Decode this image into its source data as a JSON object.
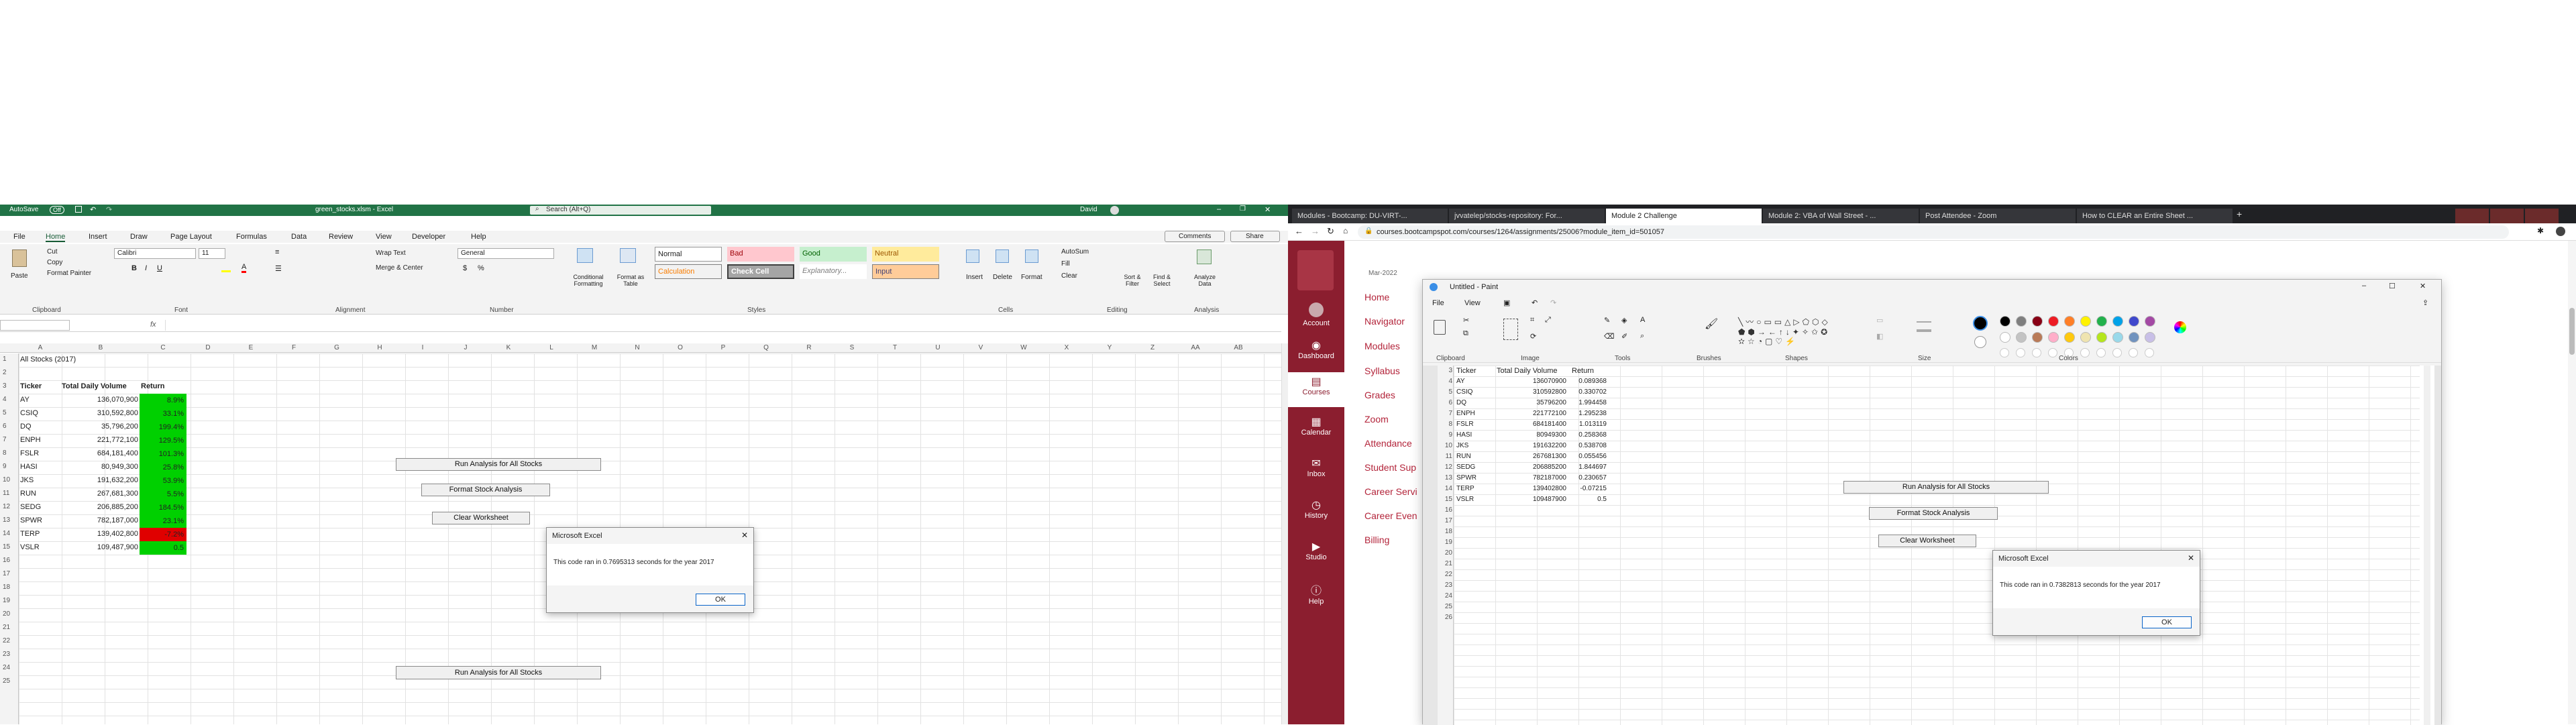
{
  "excel": {
    "autosave_label": "AutoSave",
    "autosave_state": "Off",
    "title": "green_stocks.xlsm - Excel",
    "search_placeholder": "Search (Alt+Q)",
    "user": "David",
    "menu_tabs": [
      "File",
      "Home",
      "Insert",
      "Draw",
      "Page Layout",
      "Formulas",
      "Data",
      "Review",
      "View",
      "Developer",
      "Help"
    ],
    "comments_label": "Comments",
    "share_label": "Share",
    "ribbon": {
      "paste": "Paste",
      "cut": "Cut",
      "copy": "Copy",
      "format_painter": "Format Painter",
      "font_name": "Calibri",
      "font_size": "11",
      "wrap_text": "Wrap Text",
      "merge_center": "Merge & Center",
      "number_format": "General",
      "conditional": "Conditional Formatting",
      "format_table": "Format as Table",
      "styles": [
        "Normal",
        "Bad",
        "Good",
        "Neutral",
        "Calculation",
        "Check Cell",
        "Explanatory...",
        "Input"
      ],
      "insert": "Insert",
      "delete": "Delete",
      "format": "Format",
      "autosum": "AutoSum",
      "fill": "Fill",
      "clear": "Clear",
      "sort_filter": "Sort & Filter",
      "find_select": "Find & Select",
      "analyze": "Analyze Data",
      "groups": [
        "Clipboard",
        "Font",
        "Alignment",
        "Number",
        "Styles",
        "Cells",
        "Editing",
        "Analysis"
      ]
    },
    "name_box": "",
    "formula_fx": "fx",
    "columns": [
      "A",
      "B",
      "C",
      "D",
      "E",
      "F",
      "G",
      "H",
      "I",
      "J",
      "K",
      "L",
      "M",
      "N",
      "O",
      "P",
      "Q",
      "R",
      "S",
      "T",
      "U",
      "V",
      "W",
      "X",
      "Y",
      "Z",
      "AA",
      "AB"
    ],
    "row_numbers": [
      "1",
      "2",
      "3",
      "4",
      "5",
      "6",
      "7",
      "8",
      "9",
      "10",
      "11",
      "12",
      "13",
      "14",
      "15",
      "16",
      "17",
      "18",
      "19",
      "20",
      "21",
      "22",
      "23",
      "24",
      "25"
    ],
    "sheet_title": "All Stocks (2017)",
    "headers": [
      "Ticker",
      "Total Daily Volume",
      "Return"
    ],
    "rows": [
      {
        "ticker": "AY",
        "volume": "136,070,900",
        "ret": "8.9%",
        "color": "#00d000"
      },
      {
        "ticker": "CSIQ",
        "volume": "310,592,800",
        "ret": "33.1%",
        "color": "#00d000"
      },
      {
        "ticker": "DQ",
        "volume": "35,796,200",
        "ret": "199.4%",
        "color": "#00d000"
      },
      {
        "ticker": "ENPH",
        "volume": "221,772,100",
        "ret": "129.5%",
        "color": "#00d000"
      },
      {
        "ticker": "FSLR",
        "volume": "684,181,400",
        "ret": "101.3%",
        "color": "#00d000"
      },
      {
        "ticker": "HASI",
        "volume": "80,949,300",
        "ret": "25.8%",
        "color": "#00d000"
      },
      {
        "ticker": "JKS",
        "volume": "191,632,200",
        "ret": "53.9%",
        "color": "#00d000"
      },
      {
        "ticker": "RUN",
        "volume": "267,681,300",
        "ret": "5.5%",
        "color": "#00d000"
      },
      {
        "ticker": "SEDG",
        "volume": "206,885,200",
        "ret": "184.5%",
        "color": "#00d000"
      },
      {
        "ticker": "SPWR",
        "volume": "782,187,000",
        "ret": "23.1%",
        "color": "#00d000"
      },
      {
        "ticker": "TERP",
        "volume": "139,402,800",
        "ret": "-7.2%",
        "color": "#e00000"
      },
      {
        "ticker": "VSLR",
        "volume": "109,487,900",
        "ret": "0.5",
        "color": "#00d000"
      }
    ],
    "buttons": {
      "run": "Run Analysis for All Stocks",
      "format": "Format Stock Analysis",
      "clear": "Clear Worksheet"
    },
    "dialog": {
      "title": "Microsoft Excel",
      "message": "This code ran in 0.7695313 seconds for the year 2017",
      "ok": "OK"
    }
  },
  "browser": {
    "tabs": [
      "Modules - Bootcamp: DU-VIRT-...",
      "jvvatelep/stocks-repository: For...",
      "Module 2 Challenge",
      "Module 2: VBA of Wall Street - ...",
      "Post Attendee - Zoom",
      "How to CLEAR an Entire Sheet ..."
    ],
    "url": "courses.bootcampspot.com/courses/1264/assignments/25006?module_item_id=501057",
    "canvas_nav": [
      "Account",
      "Dashboard",
      "Courses",
      "Calendar",
      "Inbox",
      "History",
      "Studio",
      "Help"
    ],
    "course_date": "Mar-2022",
    "course_nav": [
      "Home",
      "Navigator",
      "Modules",
      "Syllabus",
      "Grades",
      "Zoom",
      "Attendance",
      "Student Sup",
      "Career Servi",
      "Career Even",
      "Billing"
    ]
  },
  "paint": {
    "title": "Untitled - Paint",
    "menu": [
      "File",
      "View"
    ],
    "groups": [
      "Clipboard",
      "Image",
      "Tools",
      "Brushes",
      "Shapes",
      "Size",
      "Colors"
    ],
    "row_numbers": [
      "3",
      "4",
      "5",
      "6",
      "7",
      "8",
      "9",
      "10",
      "11",
      "12",
      "13",
      "14",
      "15",
      "16",
      "17",
      "18",
      "19",
      "20",
      "21",
      "22",
      "23",
      "24",
      "25",
      "26"
    ],
    "headers": [
      "Ticker",
      "Total Daily Volume",
      "Return"
    ],
    "rows": [
      {
        "ticker": "AY",
        "volume": "136070900",
        "ret": "0.089368"
      },
      {
        "ticker": "CSIQ",
        "volume": "310592800",
        "ret": "0.330702"
      },
      {
        "ticker": "DQ",
        "volume": "35796200",
        "ret": "1.994458"
      },
      {
        "ticker": "ENPH",
        "volume": "221772100",
        "ret": "1.295238"
      },
      {
        "ticker": "FSLR",
        "volume": "684181400",
        "ret": "1.013119"
      },
      {
        "ticker": "HASI",
        "volume": "80949300",
        "ret": "0.258368"
      },
      {
        "ticker": "JKS",
        "volume": "191632200",
        "ret": "0.538708"
      },
      {
        "ticker": "RUN",
        "volume": "267681300",
        "ret": "0.055456"
      },
      {
        "ticker": "SEDG",
        "volume": "206885200",
        "ret": "1.844697"
      },
      {
        "ticker": "SPWR",
        "volume": "782187000",
        "ret": "0.230657"
      },
      {
        "ticker": "TERP",
        "volume": "139402800",
        "ret": "-0.07215"
      },
      {
        "ticker": "VSLR",
        "volume": "109487900",
        "ret": "0.5"
      }
    ],
    "buttons": {
      "run": "Run Analysis for All Stocks",
      "format": "Format Stock Analysis",
      "clear": "Clear Worksheet"
    },
    "dialog": {
      "title": "Microsoft Excel",
      "message": "This code ran in 0.7382813 seconds for the year 2017",
      "ok": "OK"
    },
    "palette": [
      "#000000",
      "#7f7f7f",
      "#880015",
      "#ed1c24",
      "#ff7f27",
      "#fff200",
      "#22b14c",
      "#00a2e8",
      "#3f48cc",
      "#a349a4",
      "#ffffff",
      "#c3c3c3",
      "#b97a57",
      "#ffaec9",
      "#ffc90e",
      "#efe4b0",
      "#b5e61d",
      "#99d9ea",
      "#7092be",
      "#c8bfe7"
    ]
  }
}
